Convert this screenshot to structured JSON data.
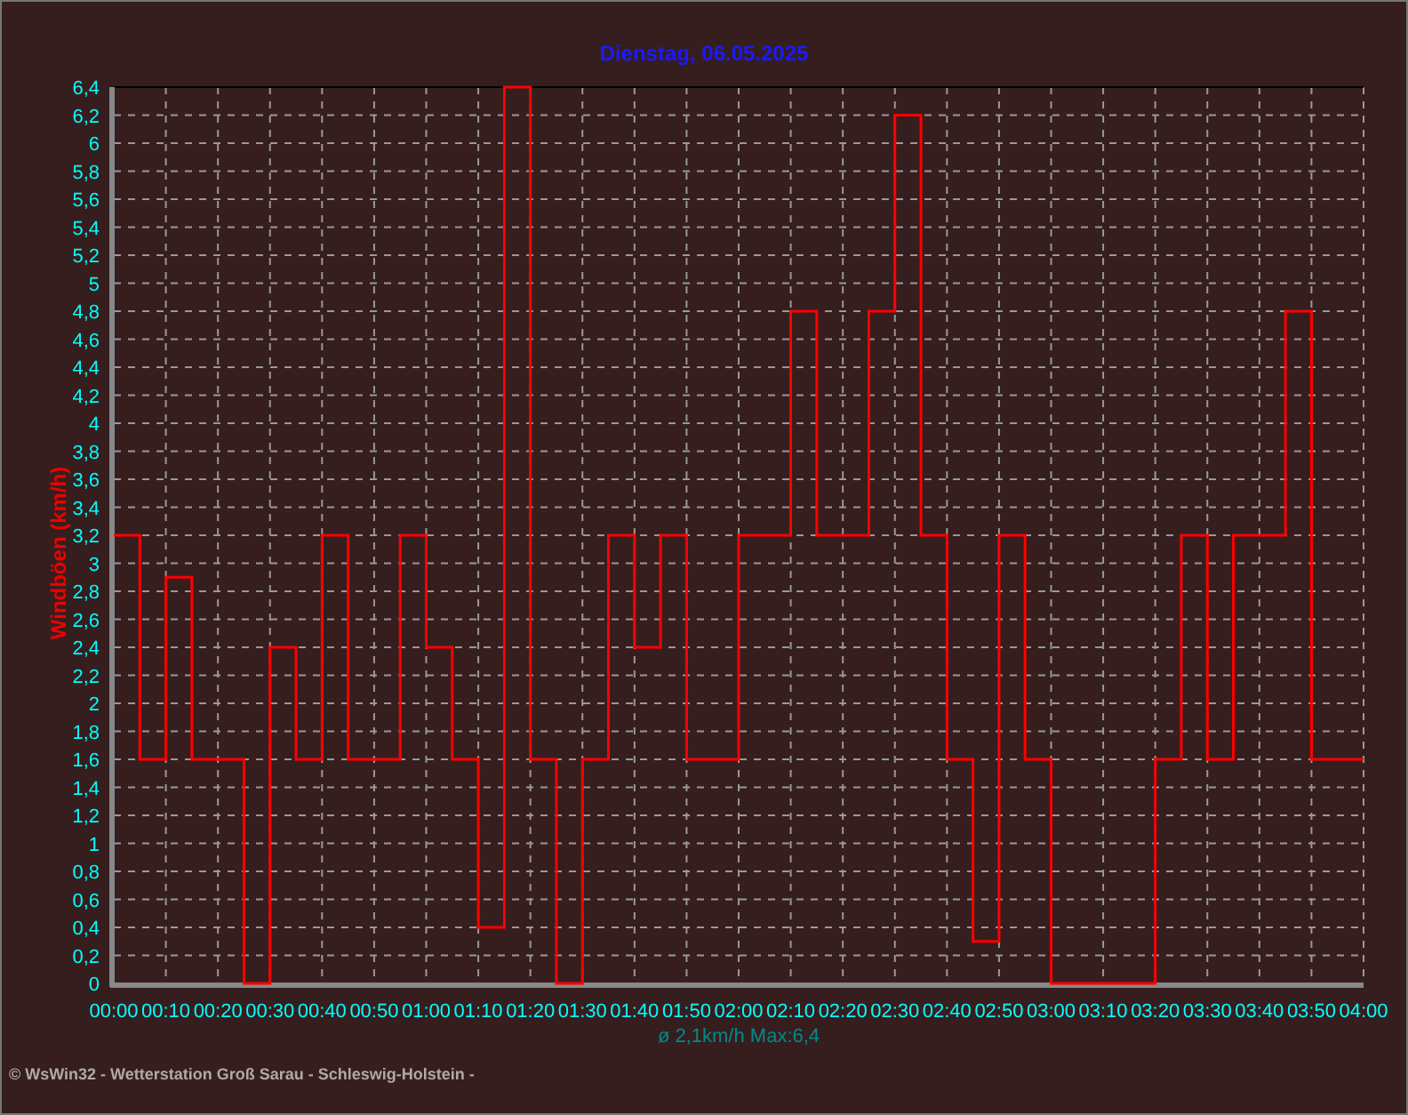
{
  "title": "Dienstag, 06.05.2025",
  "chart": {
    "chart_data": {
      "type": "line",
      "grid": true,
      "ylabel": "Windböen (km/h)",
      "x": [
        0,
        5,
        5,
        10,
        10,
        15,
        15,
        20,
        20,
        25,
        25,
        30,
        30,
        35,
        35,
        40,
        40,
        45,
        45,
        50,
        50,
        55,
        55,
        60,
        60,
        65,
        65,
        70,
        70,
        75,
        75,
        80,
        80,
        85,
        85,
        90,
        90,
        95,
        95,
        100,
        100,
        105,
        105,
        110,
        110,
        115,
        115,
        120,
        120,
        125,
        125,
        130,
        130,
        135,
        135,
        140,
        140,
        145,
        145,
        150,
        150,
        155,
        155,
        160,
        160,
        165,
        165,
        170,
        170,
        175,
        175,
        180,
        180,
        185,
        185,
        190,
        190,
        195,
        195,
        200,
        200,
        205,
        205,
        210,
        210,
        215,
        215,
        220,
        220,
        225,
        225,
        230,
        230,
        235,
        235,
        240
      ],
      "series": [
        {
          "color": "#ff0000",
          "values": [
            3.2,
            3.2,
            1.6,
            1.6,
            2.9,
            2.9,
            1.6,
            1.6,
            1.6,
            1.6,
            0,
            0,
            2.4,
            2.4,
            1.6,
            1.6,
            3.2,
            3.2,
            1.6,
            1.6,
            1.6,
            1.6,
            3.2,
            3.2,
            2.4,
            2.4,
            1.6,
            1.6,
            0.4,
            0.4,
            6.4,
            6.4,
            1.6,
            1.6,
            0,
            0,
            1.6,
            1.6,
            3.2,
            3.2,
            2.4,
            2.4,
            3.2,
            3.2,
            1.6,
            1.6,
            1.6,
            1.6,
            3.2,
            3.2,
            3.2,
            3.2,
            4.8,
            4.8,
            3.2,
            3.2,
            3.2,
            3.2,
            4.8,
            4.8,
            6.2,
            6.2,
            3.2,
            3.2,
            1.6,
            1.6,
            0.3,
            0.3,
            3.2,
            3.2,
            1.6,
            1.6,
            0,
            0,
            0,
            0,
            0,
            0,
            0,
            0,
            1.6,
            1.6,
            3.2,
            3.2,
            1.6,
            1.6,
            3.2,
            3.2,
            3.2,
            3.2,
            4.8,
            4.8,
            1.6,
            1.6,
            1.6,
            1.6
          ]
        }
      ],
      "xlim": [
        0,
        240
      ],
      "ylim": [
        0,
        6.4
      ],
      "xticks": [
        {
          "value": 0,
          "label": "00:00"
        },
        {
          "value": 10,
          "label": "00:10"
        },
        {
          "value": 20,
          "label": "00:20"
        },
        {
          "value": 30,
          "label": "00:30"
        },
        {
          "value": 40,
          "label": "00:40"
        },
        {
          "value": 50,
          "label": "00:50"
        },
        {
          "value": 60,
          "label": "01:00"
        },
        {
          "value": 70,
          "label": "01:10"
        },
        {
          "value": 80,
          "label": "01:20"
        },
        {
          "value": 90,
          "label": "01:30"
        },
        {
          "value": 100,
          "label": "01:40"
        },
        {
          "value": 110,
          "label": "01:50"
        },
        {
          "value": 120,
          "label": "02:00"
        },
        {
          "value": 130,
          "label": "02:10"
        },
        {
          "value": 140,
          "label": "02:20"
        },
        {
          "value": 150,
          "label": "02:30"
        },
        {
          "value": 160,
          "label": "02:40"
        },
        {
          "value": 170,
          "label": "02:50"
        },
        {
          "value": 180,
          "label": "03:00"
        },
        {
          "value": 190,
          "label": "03:10"
        },
        {
          "value": 200,
          "label": "03:20"
        },
        {
          "value": 210,
          "label": "03:30"
        },
        {
          "value": 220,
          "label": "03:40"
        },
        {
          "value": 230,
          "label": "03:50"
        },
        {
          "value": 240,
          "label": "04:00"
        }
      ],
      "yticks": [
        {
          "value": 0,
          "label": "0"
        },
        {
          "value": 0.2,
          "label": "0,2"
        },
        {
          "value": 0.4,
          "label": "0,4"
        },
        {
          "value": 0.6,
          "label": "0,6"
        },
        {
          "value": 0.8,
          "label": "0,8"
        },
        {
          "value": 1,
          "label": "1"
        },
        {
          "value": 1.2,
          "label": "1,2"
        },
        {
          "value": 1.4,
          "label": "1,4"
        },
        {
          "value": 1.6,
          "label": "1,6"
        },
        {
          "value": 1.8,
          "label": "1,8"
        },
        {
          "value": 2,
          "label": "2"
        },
        {
          "value": 2.2,
          "label": "2,2"
        },
        {
          "value": 2.4,
          "label": "2,4"
        },
        {
          "value": 2.6,
          "label": "2,6"
        },
        {
          "value": 2.8,
          "label": "2,8"
        },
        {
          "value": 3,
          "label": "3"
        },
        {
          "value": 3.2,
          "label": "3,2"
        },
        {
          "value": 3.4,
          "label": "3,4"
        },
        {
          "value": 3.6,
          "label": "3,6"
        },
        {
          "value": 3.8,
          "label": "3,8"
        },
        {
          "value": 4,
          "label": "4"
        },
        {
          "value": 4.2,
          "label": "4,2"
        },
        {
          "value": 4.4,
          "label": "4,4"
        },
        {
          "value": 4.6,
          "label": "4,6"
        },
        {
          "value": 4.8,
          "label": "4,8"
        },
        {
          "value": 5,
          "label": "5"
        },
        {
          "value": 5.2,
          "label": "5,2"
        },
        {
          "value": 5.4,
          "label": "5,4"
        },
        {
          "value": 5.6,
          "label": "5,6"
        },
        {
          "value": 5.8,
          "label": "5,8"
        },
        {
          "value": 6,
          "label": "6"
        },
        {
          "value": 6.2,
          "label": "6,2"
        },
        {
          "value": 6.4,
          "label": "6,4"
        }
      ],
      "annotations": [
        "ø 2,1km/h  Max:6,4"
      ]
    }
  },
  "footer": "© WsWin32  -  Wetterstation Groß Sarau - Schleswig-Holstein  -"
}
